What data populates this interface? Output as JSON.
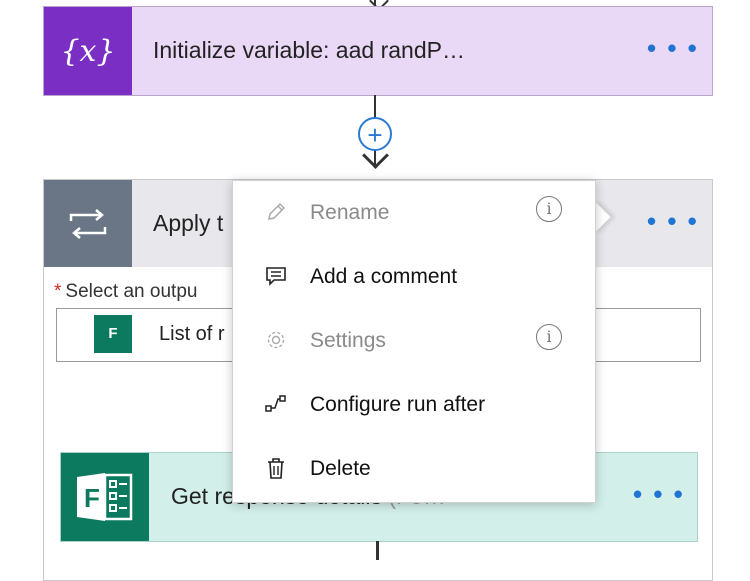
{
  "init_card": {
    "icon": "variable-icon",
    "icon_glyph": "{x}",
    "title": "Initialize variable: aad randP…",
    "more": "• • •"
  },
  "add_step": {
    "icon": "plus-icon",
    "glyph": "+"
  },
  "apply_card": {
    "icon": "loop-icon",
    "title": "Apply t",
    "more": "• • •",
    "select_label": "Select an outpu",
    "required_marker": "*",
    "token": {
      "icon": "forms-icon",
      "icon_text": "F",
      "label": "List of r"
    }
  },
  "get_card": {
    "icon": "forms-icon",
    "title": "Get r",
    "title_hidden": "esponse details",
    "title_muted": " (Fo…",
    "more": "• • •"
  },
  "context_menu": {
    "items": [
      {
        "label": "Rename",
        "icon": "pencil-icon",
        "disabled": true,
        "info": true
      },
      {
        "label": "Add a comment",
        "icon": "comment-icon",
        "disabled": false,
        "info": false
      },
      {
        "label": "Settings",
        "icon": "gear-icon",
        "disabled": true,
        "info": true
      },
      {
        "label": "Configure run after",
        "icon": "run-after-icon",
        "disabled": false,
        "info": false
      },
      {
        "label": "Delete",
        "icon": "trash-icon",
        "disabled": false,
        "info": false
      }
    ],
    "info_glyph": "i"
  },
  "colors": {
    "variable_accent": "#7b2ec4",
    "variable_bg": "#e9d8f6",
    "forms_accent": "#0b7a5e",
    "forms_bg": "#d3efe9",
    "control_accent": "#6a7586",
    "link_blue": "#1f74d4"
  }
}
